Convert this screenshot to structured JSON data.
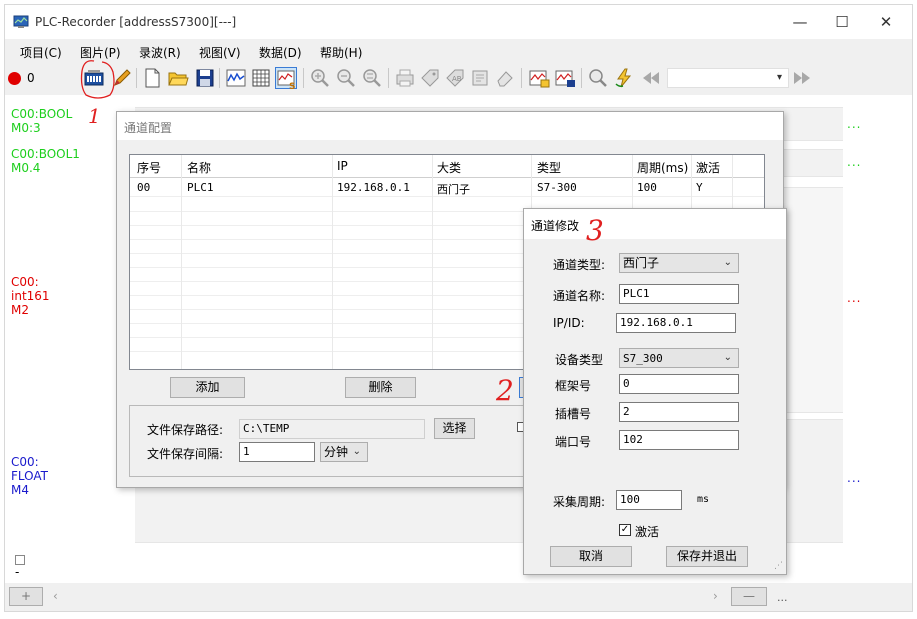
{
  "window": {
    "title": "PLC-Recorder  [addressS7300][---]",
    "controls": [
      "minimize",
      "maximize",
      "close"
    ]
  },
  "menu": [
    "项目(C)",
    "图片(P)",
    "录波(R)",
    "视图(V)",
    "数据(D)",
    "帮助(H)"
  ],
  "toolbar": {
    "record_count": "0",
    "icons": [
      "channel-config-icon",
      "pen-icon",
      "new-file-icon",
      "open-folder-icon",
      "save-icon",
      "waveform-icon",
      "grid-icon",
      "chart-s-icon",
      "zoom-in-icon",
      "zoom-out-icon",
      "zoom-fit-icon",
      "print-icon",
      "tag-icon",
      "ab-tag-icon",
      "stamp-icon",
      "eraser-icon",
      "export-chart-icon",
      "save-chart-icon",
      "magnifier-icon",
      "lightning-icon",
      "rewind-icon",
      "fast-forward-icon"
    ],
    "dropdown_value": ""
  },
  "signals": [
    {
      "lines": [
        "C00:BOOL",
        "M0:3"
      ],
      "color": "#1dcf1d"
    },
    {
      "lines": [
        "C00:BOOL1",
        "M0.4"
      ],
      "color": "#1dcf1d"
    },
    {
      "lines": [
        "C00:",
        "int161",
        "M2"
      ],
      "color": "#e00000"
    },
    {
      "lines": [
        "C00:",
        "FLOAT",
        "M4"
      ],
      "color": "#1a1acc"
    }
  ],
  "row_dots": "...",
  "bottom": {
    "checkbox_dash": "-",
    "plus": "+",
    "minus": "—",
    "ellipsis": "..."
  },
  "channel_config": {
    "title": "通道配置",
    "columns": [
      "序号",
      "名称",
      "IP",
      "大类",
      "类型",
      "周期(ms)",
      "激活"
    ],
    "rows": [
      [
        "00",
        "PLC1",
        "192.168.0.1",
        "西门子",
        "S7-300",
        "100",
        "Y"
      ]
    ],
    "add_button": "添加",
    "delete_button": "删除",
    "save_path_label": "文件保存路径:",
    "save_path_value": "C:\\TEMP",
    "choose_button": "选择",
    "save_interval_label": "文件保存间隔:",
    "save_interval_value": "1",
    "interval_unit": "分钟"
  },
  "channel_edit": {
    "title": "通道修改",
    "channel_type_label": "通道类型:",
    "channel_type_value": "西门子",
    "channel_name_label": "通道名称:",
    "channel_name_value": "PLC1",
    "ip_label": "IP/ID:",
    "ip_value": "192.168.0.1",
    "device_type_label": "设备类型",
    "device_type_value": "S7_300",
    "rack_label": "框架号",
    "rack_value": "0",
    "slot_label": "插槽号",
    "slot_value": "2",
    "port_label": "端口号",
    "port_value": "102",
    "period_label": "采集周期:",
    "period_value": "100",
    "period_unit": "ms",
    "active_label": "激活",
    "active_checked": true,
    "cancel_button": "取消",
    "save_exit_button": "保存并退出"
  },
  "annotations": [
    "1",
    "2",
    "3"
  ],
  "colors": {
    "accent_red": "#e02020",
    "record_dot": "#e00000"
  }
}
